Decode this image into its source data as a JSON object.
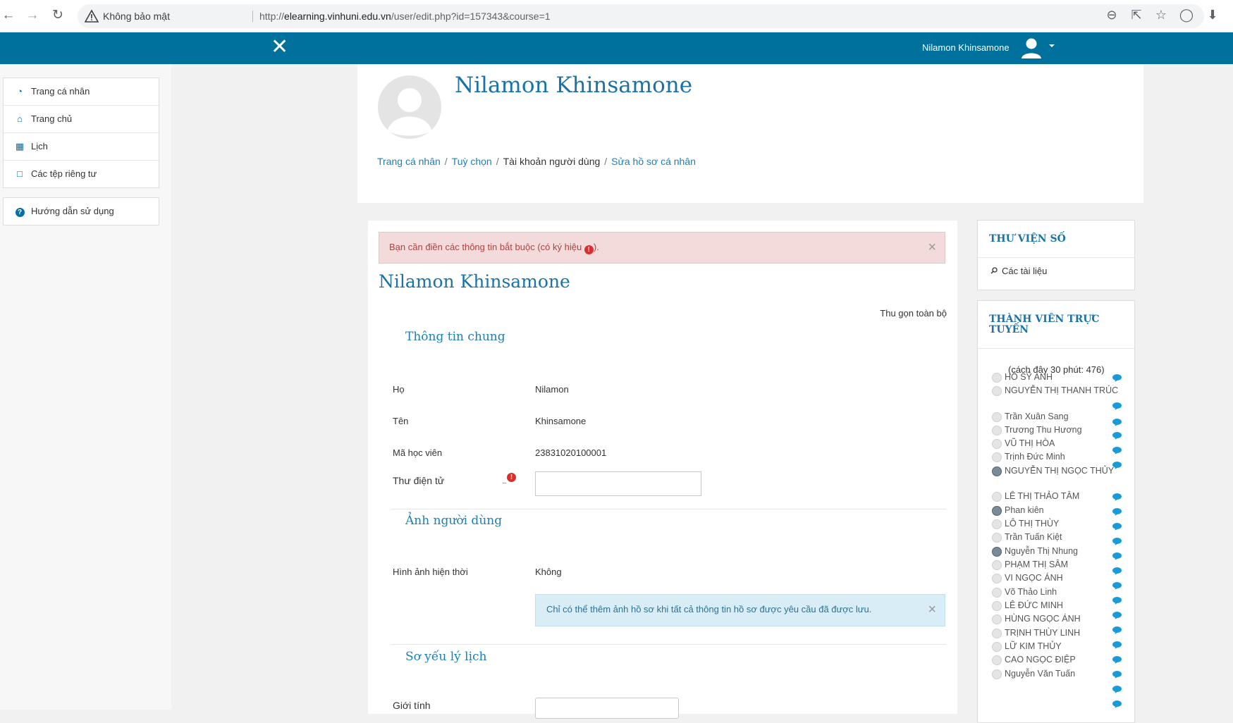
{
  "browser": {
    "security_label": "Không bảo mật",
    "url_prefix": "http://",
    "url_host": "elearning.vinhuni.edu.vn",
    "url_path": "/user/edit.php?id=157343&course=1"
  },
  "navbar": {
    "user_name": "Nilamon Khinsamone"
  },
  "drawer": {
    "items": [
      {
        "label": "Trang cá nhân",
        "icon": "dashboard-icon"
      },
      {
        "label": "Trang chủ",
        "icon": "home-icon"
      },
      {
        "label": "Lịch",
        "icon": "calendar-icon"
      },
      {
        "label": "Các tệp riêng tư",
        "icon": "file-icon"
      }
    ],
    "help": {
      "label": "Hướng dẫn sử dụng",
      "icon": "help-icon"
    }
  },
  "header": {
    "name": "Nilamon Khinsamone",
    "breadcrumb": [
      "Trang cá nhân",
      "Tuỳ chọn",
      "Tài khoản người dùng",
      "Sửa hồ sơ cá nhân"
    ]
  },
  "form": {
    "alert_required_before": "Bạn cần điền các thông tin bắt buộc (có ký hiệu",
    "alert_required_after": ").",
    "alert_close": "×",
    "title": "Nilamon Khinsamone",
    "collapse_all": "Thu gọn toàn bộ",
    "section_general": "Thông tin chung",
    "fields": {
      "lastname_label": "Họ",
      "lastname_value": "Nilamon",
      "firstname_label": "Tên",
      "firstname_value": "Khinsamone",
      "student_id_label": "Mã học viên",
      "student_id_value": "23831020100001",
      "email_label": "Thư điện tử",
      "email_value": ""
    },
    "section_picture": "Ảnh người dùng",
    "current_picture_label": "Hình ảnh hiện thời",
    "current_picture_value": "Không",
    "picture_info": "Chỉ có thể thêm ảnh hồ sơ khi tất cả thông tin hồ sơ được yêu cầu đã được lưu.",
    "section_cv": "Sơ yếu lý lịch",
    "gender_label": "Giới tính"
  },
  "blocks": {
    "library": {
      "title": "THƯ VIỆN SỐ",
      "item": "Các tài liệu"
    },
    "online": {
      "title": "THÀNH VIÊN TRỰC TUYẾN",
      "count_text": "(cách đây 30 phút: 476)",
      "users": [
        "HỒ SỸ ANH",
        "NGUYỄN THỊ THANH TRÚC",
        "Trần Xuân Sang",
        "Trương Thu Hương",
        "VŨ THỊ HÒA",
        "Trịnh Đức Minh",
        "NGUYỄN THỊ NGỌC THỦY",
        "LÊ THỊ THẢO TÂM",
        "Phan kiên",
        "LÔ THỊ THÙY",
        "Trần Tuấn Kiệt",
        "Nguyễn Thị Nhung",
        "PHẠM THỊ SÂM",
        "VI NGỌC ÁNH",
        "Võ Thảo Linh",
        "LÊ ĐỨC MINH",
        "HÙNG NGỌC ÁNH",
        "TRỊNH THÙY LINH",
        "LỮ KIM THỦY",
        "CAO NGỌC ĐIỆP",
        "Nguyễn Văn Tuấn"
      ]
    }
  }
}
